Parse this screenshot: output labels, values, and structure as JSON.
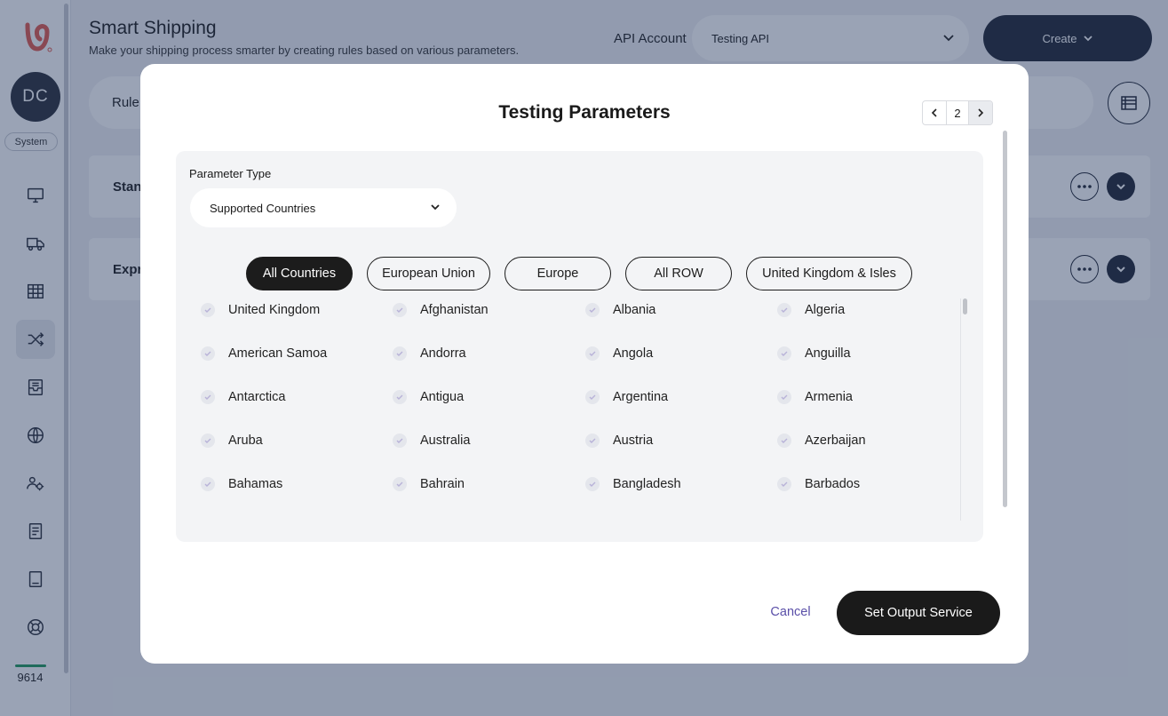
{
  "sidebar": {
    "avatar_initials": "DC",
    "system_badge": "System",
    "credits": "9614",
    "nav_icons": [
      "monitor-icon",
      "truck-icon",
      "grid-icon",
      "shuffle-icon",
      "inbox-icon",
      "globe-icon",
      "users-gear-icon",
      "book-icon",
      "tablet-icon",
      "lifebuoy-icon"
    ],
    "active_nav": "shuffle-icon"
  },
  "header": {
    "title": "Smart Shipping",
    "subtitle": "Make your shipping process smarter by creating rules based on various parameters.",
    "api_account_label": "API Account",
    "api_account_value": "Testing API",
    "create_label": "Create"
  },
  "rules": {
    "rule_bar_label": "Rule",
    "cards": [
      "Stan",
      "Expr"
    ]
  },
  "modal": {
    "title": "Testing Parameters",
    "pager": {
      "page": "2"
    },
    "parameter_type_label": "Parameter Type",
    "parameter_type_value": "Supported Countries",
    "filters": [
      {
        "label": "All Countries",
        "active": true
      },
      {
        "label": "European Union",
        "active": false
      },
      {
        "label": "Europe",
        "active": false
      },
      {
        "label": "All ROW",
        "active": false
      },
      {
        "label": "United Kingdom & Isles",
        "active": false
      }
    ],
    "countries": [
      "United Kingdom",
      "Afghanistan",
      "Albania",
      "Algeria",
      "American Samoa",
      "Andorra",
      "Angola",
      "Anguilla",
      "Antarctica",
      "Antigua",
      "Argentina",
      "Armenia",
      "Aruba",
      "Australia",
      "Austria",
      "Azerbaijan",
      "Bahamas",
      "Bahrain",
      "Bangladesh",
      "Barbados"
    ],
    "cancel_label": "Cancel",
    "submit_label": "Set Output Service"
  },
  "colors": {
    "dark": "#1c1c1c",
    "navy": "#1f2533",
    "link_purple": "#5a4fa8",
    "credit_green": "#1f9a5c",
    "overlay": "#20345a"
  }
}
